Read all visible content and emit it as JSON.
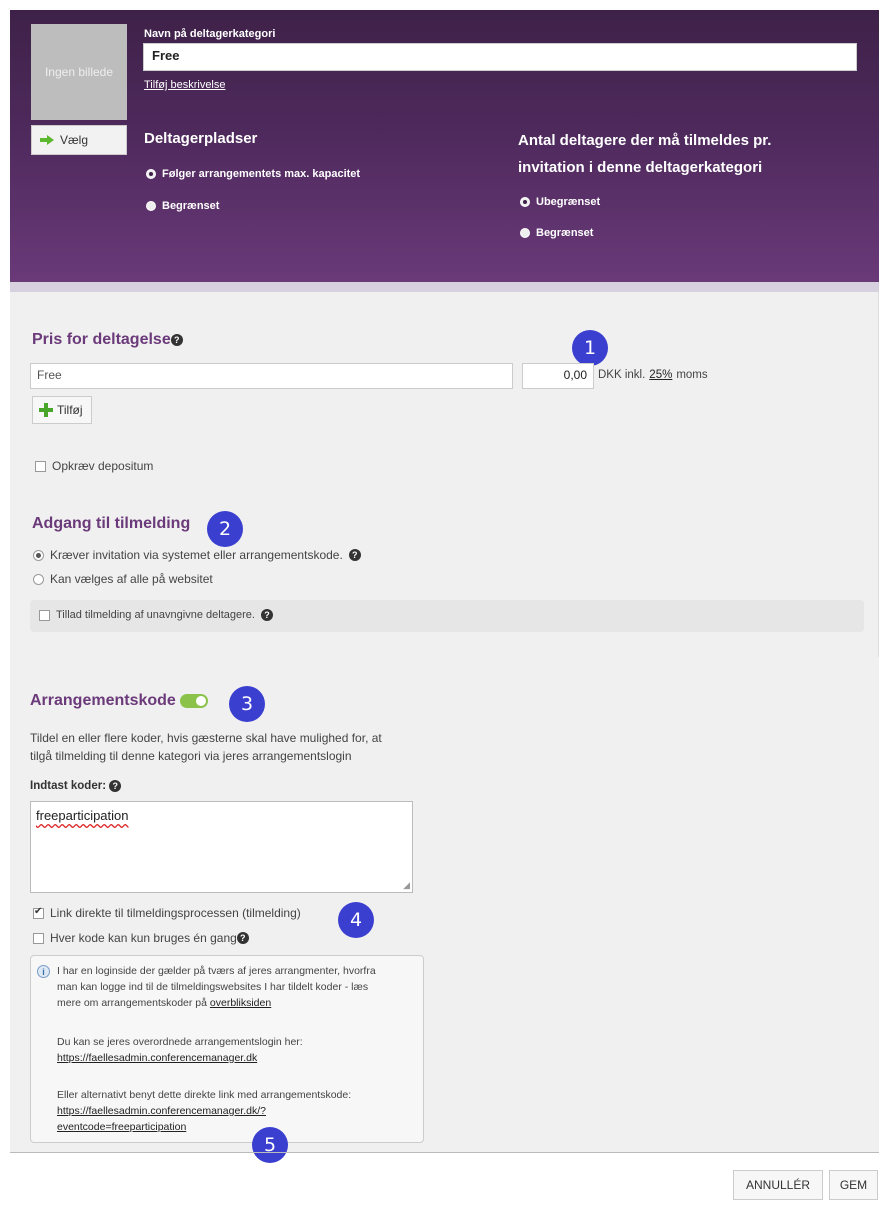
{
  "header": {
    "image_placeholder": "Ingen billede",
    "choose_button": "Vælg",
    "name_label": "Navn på deltagerkategori",
    "name_value": "Free",
    "add_description_link": "Tilføj beskrivelse",
    "seats_heading": "Deltagerpladser",
    "seats_options": [
      "Følger arrangementets max. kapacitet",
      "Begrænset"
    ],
    "per_invitation_heading_line1": "Antal deltagere der må tilmeldes pr.",
    "per_invitation_heading_line2": "invitation i denne deltagerkategori",
    "per_invitation_options": [
      "Ubegrænset",
      "Begrænset"
    ]
  },
  "price": {
    "heading": "Pris for deltagelse",
    "name_value": "Free",
    "amount_value": "0,00",
    "currency_text": "DKK inkl.",
    "vat_link": "25%",
    "vat_suffix": "moms",
    "add_button": "Tilføj",
    "deposit_label": "Opkræv depositum"
  },
  "access": {
    "heading": "Adgang til tilmelding",
    "options": [
      "Kræver invitation via systemet eller arrangementskode.",
      "Kan vælges af alle på websitet"
    ],
    "anonymous_label": "Tillad tilmelding af unavngivne deltagere."
  },
  "eventcode": {
    "heading": "Arrangementskode",
    "description_line1": "Tildel en eller flere koder, hvis gæsterne skal have mulighed for, at",
    "description_line2": "tilgå tilmelding til denne kategori via jeres arrangementslogin",
    "codes_label": "Indtast koder:",
    "codes_value": "freeparticipation",
    "link_direct_label": "Link direkte til tilmeldingsprocessen (tilmelding)",
    "single_use_label": "Hver kode kan kun bruges én gang"
  },
  "info": {
    "p1_line1": "I har en loginside der gælder på tværs af jeres arrangmenter, hvorfra",
    "p1_line2": "man kan logge ind til de tilmeldingswebsites I har tildelt koder - læs",
    "p1_line3": "mere om arrangementskoder på",
    "p1_link": "overbliksiden",
    "p2_line1": "Du kan se jeres overordnede arrangementslogin her:",
    "p2_link": "https://faellesadmin.conferencemanager.dk",
    "p3_line1": "Eller alternativt benyt dette direkte link med arrangementskode:",
    "p3_link_line1": "https://faellesadmin.conferencemanager.dk/?",
    "p3_link_line2": "eventcode=freeparticipation"
  },
  "badges": [
    "1",
    "2",
    "3",
    "4",
    "5"
  ],
  "footer": {
    "cancel_button": "ANNULLÉR",
    "save_button": "GEM"
  },
  "colors": {
    "header_purple": "#4f2a5d",
    "heading_purple": "#6b3a7a",
    "badge_blue": "#3a3fd0",
    "toggle_green": "#8bc34a"
  }
}
